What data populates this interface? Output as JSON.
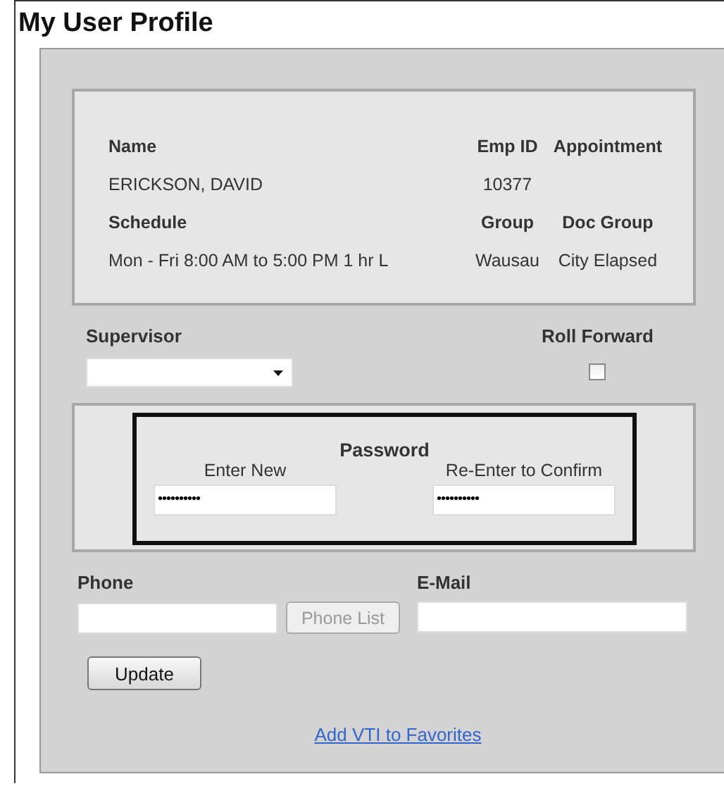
{
  "title": "My User Profile",
  "info": {
    "rows": [
      {
        "kind": "header",
        "cells": [
          "Name",
          "Emp ID",
          "Appointment"
        ]
      },
      {
        "kind": "value",
        "cells": [
          "ERICKSON, DAVID",
          "10377",
          ""
        ]
      },
      {
        "kind": "header",
        "cells": [
          "Schedule",
          "Group",
          "Doc Group"
        ]
      },
      {
        "kind": "value",
        "cells": [
          "Mon - Fri 8:00 AM to 5:00 PM 1 hr L",
          "Wausau",
          "City Elapsed"
        ]
      }
    ]
  },
  "supervisor": {
    "label": "Supervisor"
  },
  "roll_forward": {
    "label": "Roll Forward",
    "checked": false
  },
  "password": {
    "title": "Password",
    "fields": [
      {
        "label": "Enter New",
        "value": "••••••••••"
      },
      {
        "label": "Re-Enter to Confirm",
        "value": "••••••••••"
      }
    ]
  },
  "phone": {
    "label": "Phone",
    "button": {
      "label": "Phone List",
      "disabled": true
    }
  },
  "email": {
    "label": "E-Mail"
  },
  "update_button": "Update",
  "link": "Add VTI to Favorites"
}
